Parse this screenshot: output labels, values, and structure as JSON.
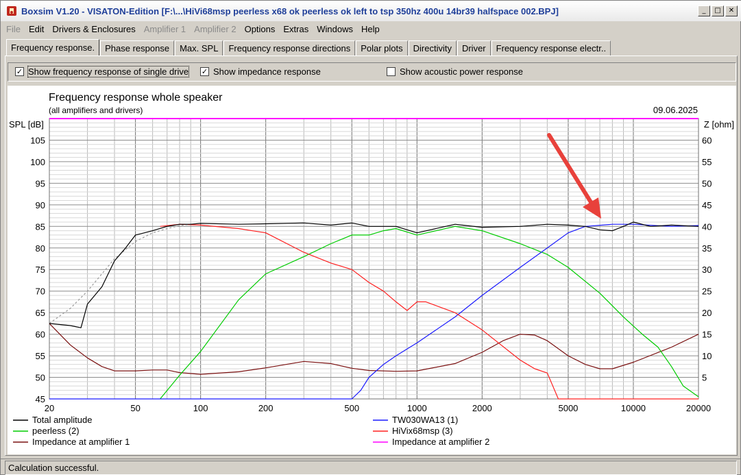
{
  "window": {
    "title": "Boxsim V1.20 - VISATON-Edition [F:\\...\\HiVi68msp peerless x68 ok peerless ok left to tsp 350hz 400u 14br39 halfspace 002.BPJ]",
    "buttons": {
      "minimize": "_",
      "maximize": "□",
      "close": "✕"
    }
  },
  "menu": [
    {
      "label": "File",
      "enabled": false
    },
    {
      "label": "Edit",
      "enabled": true
    },
    {
      "label": "Drivers & Enclosures",
      "enabled": true
    },
    {
      "label": "Amplifier 1",
      "enabled": false
    },
    {
      "label": "Amplifier 2",
      "enabled": false
    },
    {
      "label": "Options",
      "enabled": true
    },
    {
      "label": "Extras",
      "enabled": true
    },
    {
      "label": "Windows",
      "enabled": true
    },
    {
      "label": "Help",
      "enabled": true
    }
  ],
  "tabs": [
    {
      "label": "Frequency response.",
      "active": true
    },
    {
      "label": "Phase response",
      "active": false
    },
    {
      "label": "Max. SPL",
      "active": false
    },
    {
      "label": "Frequency response directions",
      "active": false
    },
    {
      "label": "Polar plots",
      "active": false
    },
    {
      "label": "Directivity",
      "active": false
    },
    {
      "label": "Driver",
      "active": false
    },
    {
      "label": "Frequency response electr..",
      "active": false
    }
  ],
  "options": {
    "single_drive": {
      "label": "Show frequency response of single drive",
      "checked": true
    },
    "impedance": {
      "label": "Show impedance response",
      "checked": true
    },
    "acoustic_power": {
      "label": "Show acoustic power response",
      "checked": false
    }
  },
  "status": "Calculation successful.",
  "colors": {
    "total": "#000000",
    "peerless": "#00cc00",
    "impedance1": "#7a1010",
    "tw030": "#1a1aff",
    "hivi": "#ff2020",
    "impedance2": "#ff00ff",
    "arrow": "#e8413b",
    "grid": "#b8b8b8"
  },
  "chart_data": {
    "type": "line",
    "title": "Frequency response whole speaker",
    "subtitle": "(all amplifiers and drivers)",
    "date": "09.06.2025",
    "ylabel": "SPL [dB]",
    "y2label": "Z [ohm]",
    "x_scale": "log",
    "xlim": [
      20,
      20000
    ],
    "ylim": [
      45,
      110
    ],
    "y2lim": [
      0,
      65
    ],
    "x_ticks": [
      20,
      50,
      100,
      200,
      500,
      1000,
      2000,
      5000,
      10000,
      20000
    ],
    "x_tick_labels": [
      "20",
      "50",
      "100",
      "200",
      "500",
      "1000",
      "2000",
      "5000",
      "10000",
      "20000"
    ],
    "y_ticks": [
      45,
      50,
      55,
      60,
      65,
      70,
      75,
      80,
      85,
      90,
      95,
      100,
      105
    ],
    "y2_ticks": [
      5,
      10,
      15,
      20,
      25,
      30,
      35,
      40,
      45,
      50,
      55,
      60
    ],
    "grid": true,
    "legend": [
      {
        "name": "Total amplitude",
        "series": "total"
      },
      {
        "name": "TW030WA13 (1)",
        "series": "tw030"
      },
      {
        "name": "peerless (2)",
        "series": "peerless"
      },
      {
        "name": "HiVix68msp (3)",
        "series": "hivi"
      },
      {
        "name": "Impedance at amplifier 1",
        "series": "impedance1"
      },
      {
        "name": "Impedance at amplifier 2",
        "series": "impedance2"
      }
    ],
    "series": [
      {
        "key": "total",
        "axis": "left",
        "x": [
          20,
          25,
          28,
          30,
          35,
          40,
          45,
          50,
          55,
          60,
          70,
          80,
          90,
          100,
          150,
          200,
          300,
          400,
          500,
          600,
          800,
          1000,
          1500,
          2000,
          3000,
          4000,
          5000,
          6000,
          7000,
          8000,
          9000,
          10000,
          12000,
          15000,
          20000
        ],
        "y": [
          62.5,
          62,
          61.5,
          67,
          71,
          77,
          80,
          83,
          83.5,
          84,
          85,
          85.5,
          85.5,
          85.7,
          85.5,
          85.6,
          85.8,
          85.3,
          85.8,
          85,
          85,
          83.5,
          85.5,
          84.8,
          85,
          85.5,
          85.3,
          85,
          84.2,
          84,
          85,
          86,
          85,
          85.3,
          85
        ]
      },
      {
        "key": "dashed_total",
        "axis": "left",
        "dashed": true,
        "x": [
          20,
          25,
          30,
          35,
          40,
          50,
          60,
          70,
          80,
          90
        ],
        "y": [
          62.5,
          66,
          70,
          74,
          77.5,
          81.5,
          83.5,
          84.5,
          85.2,
          85.5
        ]
      },
      {
        "key": "peerless",
        "axis": "left",
        "x": [
          65,
          80,
          100,
          150,
          200,
          300,
          400,
          500,
          600,
          700,
          800,
          1000,
          1500,
          2000,
          3000,
          4000,
          5000,
          7000,
          9000,
          11000,
          13000,
          15000,
          17000,
          20000
        ],
        "y": [
          45,
          50.5,
          56,
          68,
          74,
          78,
          81,
          83,
          83,
          84,
          84.5,
          83,
          85,
          84,
          81,
          78.5,
          75.5,
          69.5,
          64,
          60,
          57,
          52.5,
          48,
          45.5
        ]
      },
      {
        "key": "tw030",
        "axis": "left",
        "x": [
          20,
          500,
          550,
          600,
          700,
          800,
          1000,
          1500,
          2000,
          3000,
          4000,
          5000,
          6000,
          8000,
          10000,
          15000,
          20000
        ],
        "y": [
          45,
          45,
          47,
          50,
          53,
          55,
          58,
          64,
          69,
          75.5,
          80,
          83.5,
          85,
          85.5,
          85.5,
          85,
          85.2
        ]
      },
      {
        "key": "hivi",
        "axis": "left",
        "x": [
          65,
          80,
          100,
          150,
          200,
          300,
          400,
          500,
          600,
          700,
          800,
          900,
          1000,
          1100,
          1500,
          2000,
          3000,
          3500,
          4000,
          4500,
          20000
        ],
        "y": [
          85,
          85.5,
          85.3,
          84.5,
          83.5,
          79,
          76.5,
          75,
          72,
          70,
          67.5,
          65.5,
          67.5,
          67.5,
          65,
          61,
          54,
          52,
          51,
          45,
          45
        ]
      },
      {
        "key": "impedance1",
        "axis": "right",
        "x": [
          20,
          25,
          30,
          35,
          40,
          50,
          60,
          70,
          80,
          100,
          150,
          200,
          300,
          400,
          500,
          600,
          800,
          1000,
          1500,
          2000,
          2500,
          3000,
          3500,
          4000,
          5000,
          6000,
          7000,
          8000,
          10000,
          15000,
          20000
        ],
        "y": [
          17.5,
          12.5,
          9.5,
          7.5,
          6.5,
          6.5,
          6.7,
          6.7,
          6.1,
          5.7,
          6.3,
          7.2,
          8.7,
          8.2,
          7.1,
          6.6,
          6.4,
          6.5,
          8.2,
          10.8,
          13.5,
          15,
          14.8,
          13.5,
          10,
          8,
          7,
          7,
          8.5,
          12,
          15
        ]
      },
      {
        "key": "impedance2",
        "axis": "right",
        "x": [
          20,
          20000
        ],
        "y": [
          65,
          65
        ]
      }
    ]
  }
}
